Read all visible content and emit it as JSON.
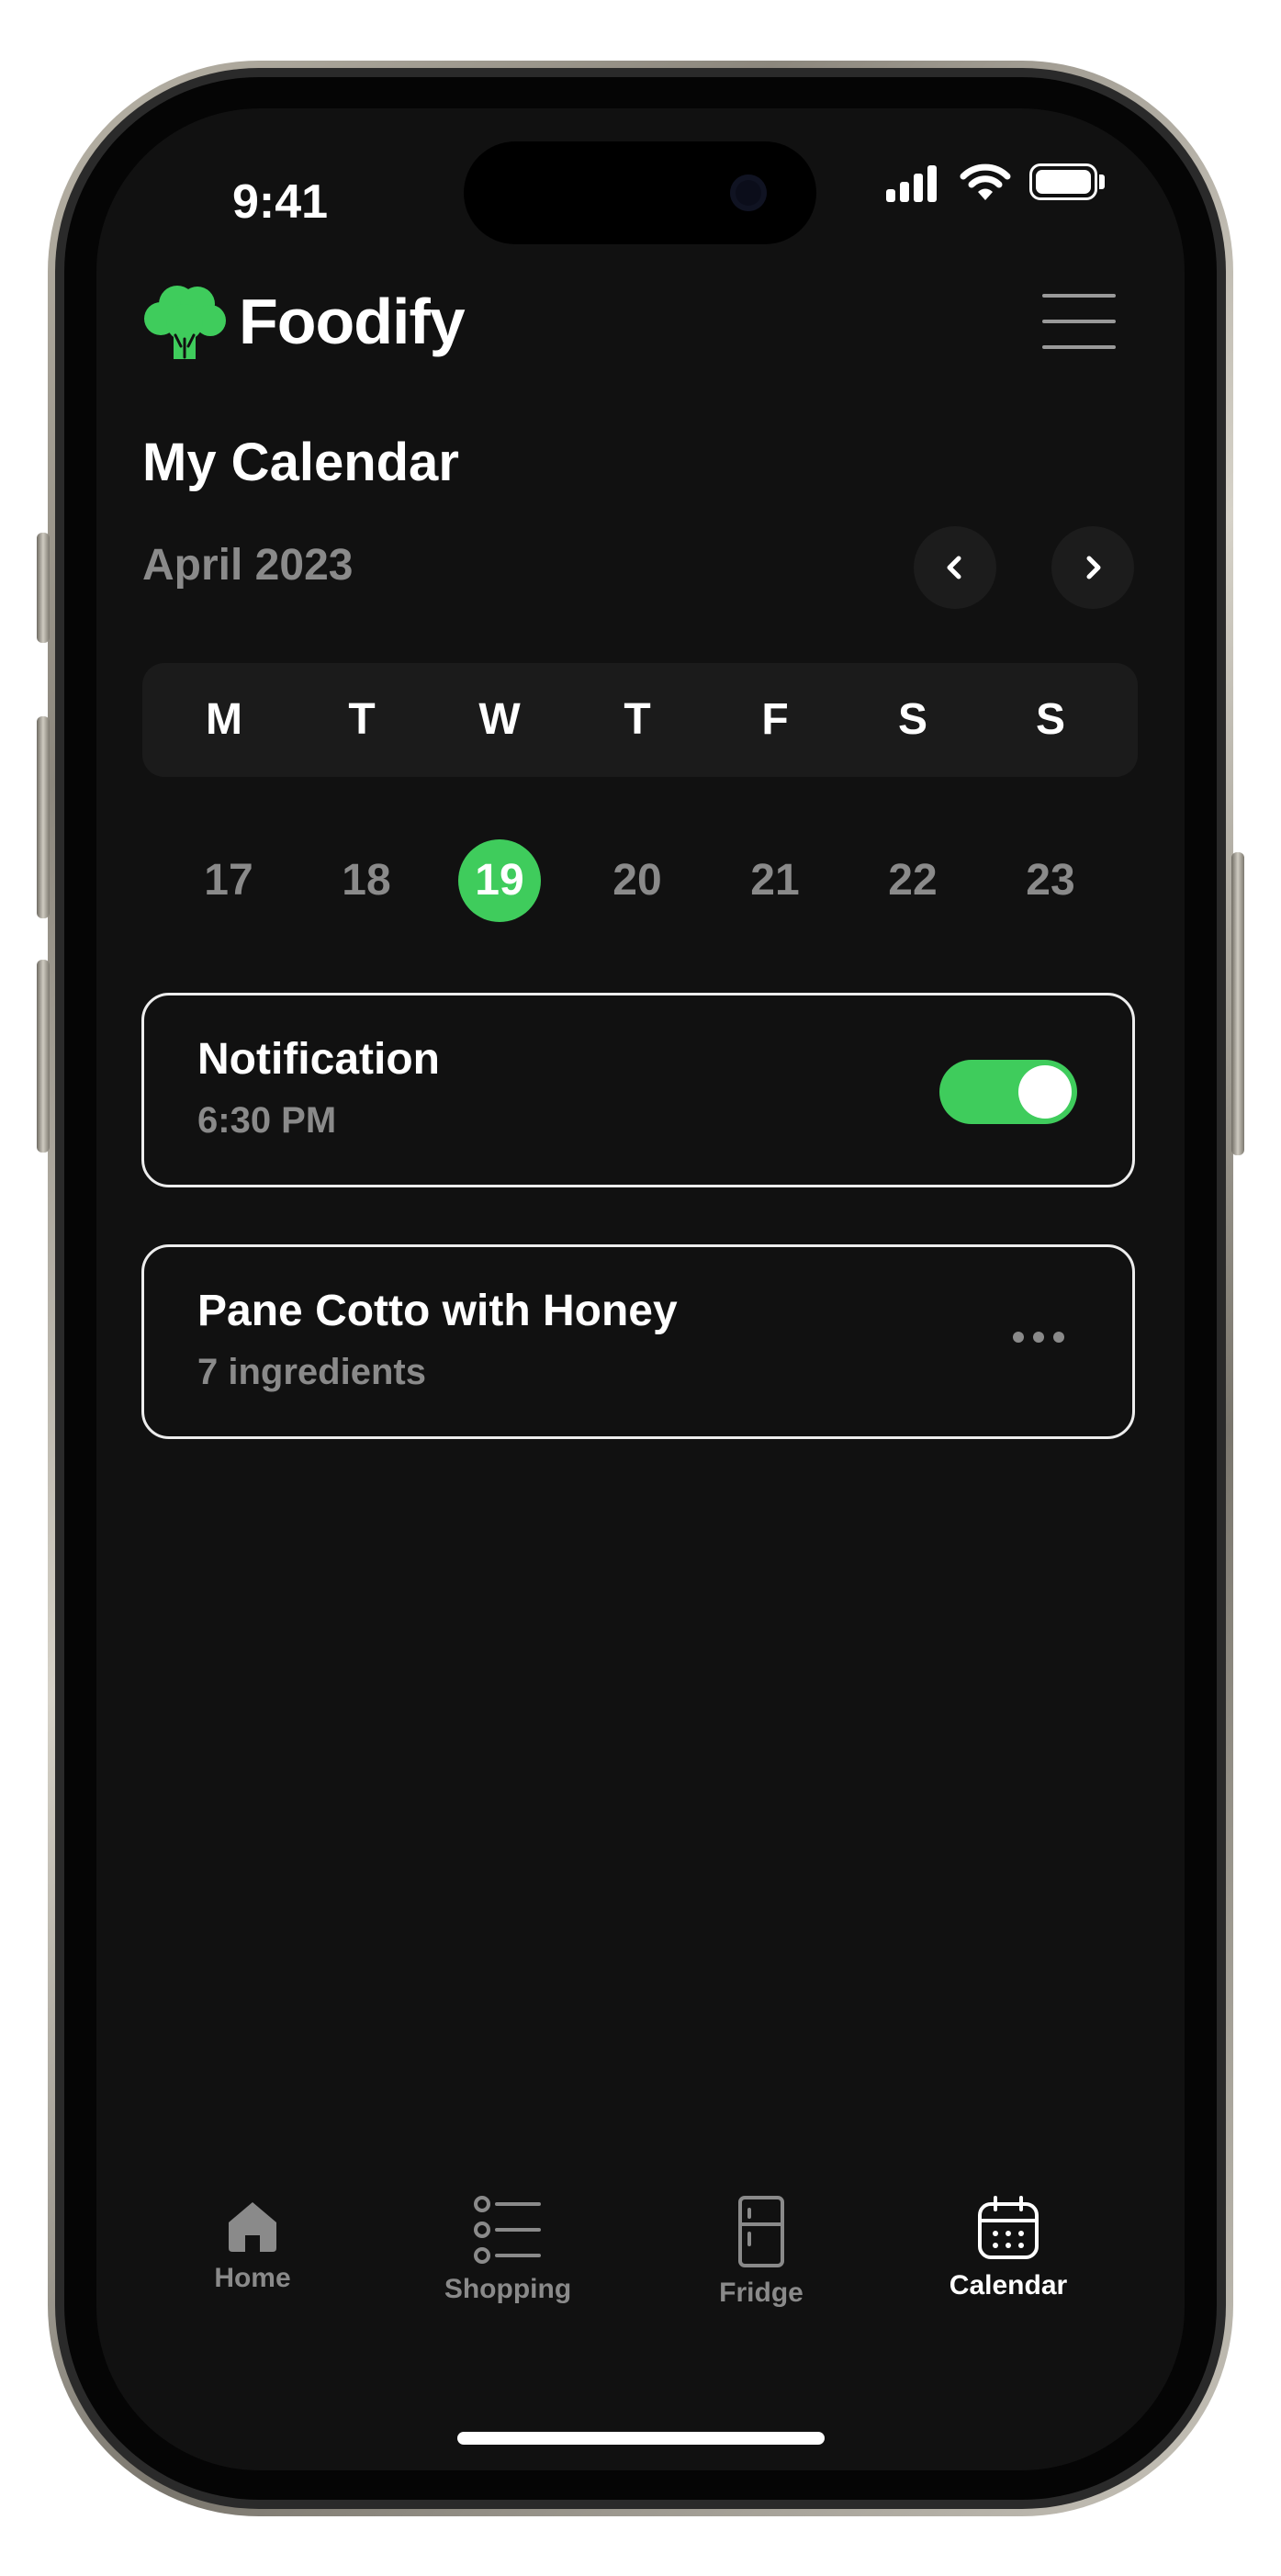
{
  "status_bar": {
    "time": "9:41"
  },
  "header": {
    "brand": "Foodify"
  },
  "page": {
    "title": "My Calendar",
    "month": "April 2023"
  },
  "week": {
    "weekdays": [
      "M",
      "T",
      "W",
      "T",
      "F",
      "S",
      "S"
    ],
    "dates": [
      "17",
      "18",
      "19",
      "20",
      "21",
      "22",
      "23"
    ],
    "selected": "19"
  },
  "notification": {
    "title": "Notification",
    "time": "6:30 PM",
    "enabled": true
  },
  "meal": {
    "title": "Pane Cotto with Honey",
    "subtitle": "7 ingredients"
  },
  "tabs": [
    {
      "label": "Home",
      "icon": "home-icon"
    },
    {
      "label": "Shopping",
      "icon": "list-icon"
    },
    {
      "label": "Fridge",
      "icon": "fridge-icon"
    },
    {
      "label": "Calendar",
      "icon": "calendar-icon",
      "active": true
    }
  ],
  "colors": {
    "accent": "#3fcc5c",
    "background": "#111111",
    "muted": "#8a8a8a"
  }
}
